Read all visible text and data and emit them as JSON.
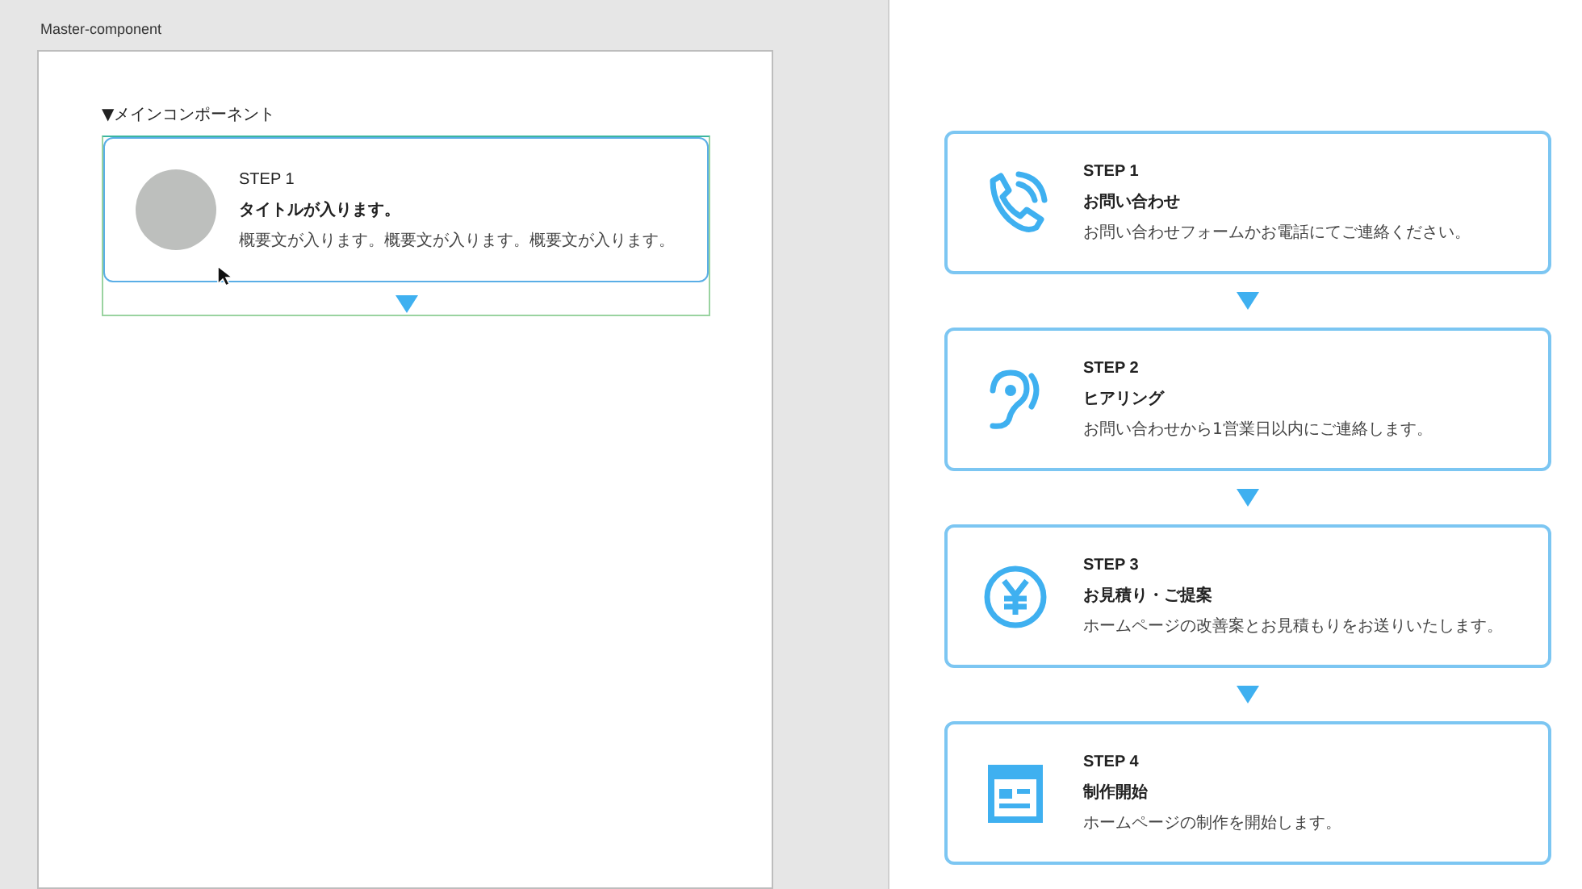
{
  "artboard": {
    "title": "Master-component",
    "heading": "▼メインコンポーネント",
    "card": {
      "step": "STEP 1",
      "title": "タイトルが入ります。",
      "description": "概要文が入ります。概要文が入ります。概要文が入ります。"
    }
  },
  "steps": [
    {
      "kind": "phone",
      "step": "STEP 1",
      "title": "お問い合わせ",
      "description": "お問い合わせフォームかお電話にてご連絡ください。"
    },
    {
      "kind": "ear",
      "step": "STEP 2",
      "title": "ヒアリング",
      "description": "お問い合わせから1営業日以内にご連絡します。"
    },
    {
      "kind": "yen",
      "step": "STEP 3",
      "title": "お見積り・ご提案",
      "description": "ホームページの改善案とお見積もりをお送りいたします。"
    },
    {
      "kind": "browser",
      "step": "STEP 4",
      "title": "制作開始",
      "description": "ホームページの制作を開始します。"
    }
  ]
}
